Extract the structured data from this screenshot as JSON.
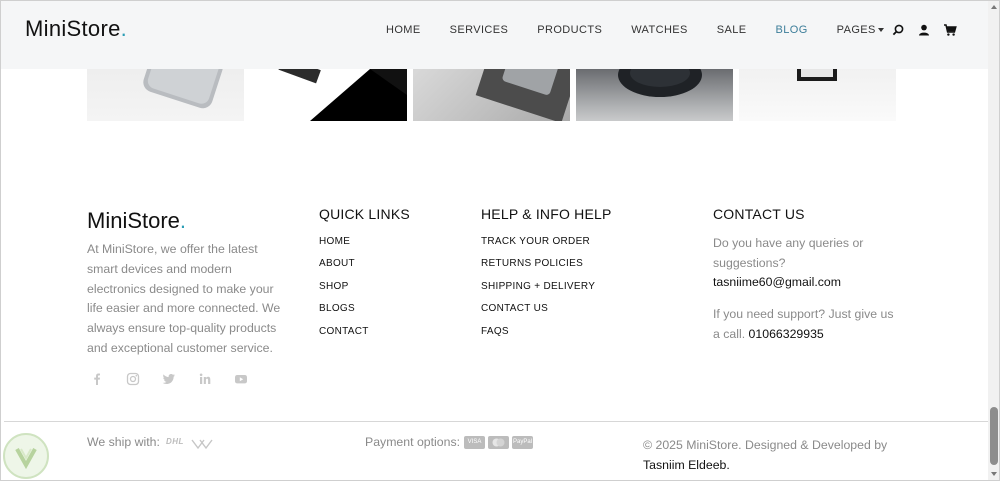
{
  "header": {
    "brand": "MiniStore",
    "brand_dot": ".",
    "nav": [
      "HOME",
      "SERVICES",
      "PRODUCTS",
      "WATCHES",
      "SALE",
      "BLOG",
      "PAGES"
    ],
    "active_nav": "BLOG",
    "icons": [
      "search-icon",
      "user-icon",
      "cart-icon"
    ]
  },
  "footer": {
    "brand": "MiniStore",
    "brand_dot": ".",
    "about": "At MiniStore, we offer the latest smart devices and modern electronics designed to make your life easier and more connected. We always ensure top-quality products and exceptional customer service.",
    "social_icons": [
      "facebook-icon",
      "instagram-icon",
      "twitter-icon",
      "linkedin-icon",
      "youtube-icon"
    ],
    "quick_links": {
      "title": "QUICK LINKS",
      "items": [
        "HOME",
        "ABOUT",
        "SHOP",
        "BLOGS",
        "CONTACT"
      ]
    },
    "help": {
      "title": "HELP & INFO HELP",
      "items": [
        "TRACK YOUR ORDER",
        "RETURNS POLICIES",
        "SHIPPING + DELIVERY",
        "CONTACT US",
        "FAQS"
      ]
    },
    "contact": {
      "title": "CONTACT US",
      "query_text": "Do you have any queries or suggestions?",
      "email": "tasniime60@gmail.com",
      "support_text": "If you need support? Just give us a call.",
      "phone": "01066329935"
    }
  },
  "bottom": {
    "ship_label": "We ship with:",
    "ship_logos": [
      "DHL",
      "shipping-carrier-logo"
    ],
    "payment_label": "Payment options:",
    "payment_logos": [
      "VISA",
      "mastercard",
      "PayPal"
    ],
    "copyright": "© 2025 MiniStore. Designed & Developed by",
    "developer": "Tasniim Eldeeb."
  },
  "colors": {
    "accent": "#2a9db5",
    "active_nav": "#3d7e9a",
    "muted_text": "#8a8a8a",
    "header_bg": "#f5f6f7"
  }
}
